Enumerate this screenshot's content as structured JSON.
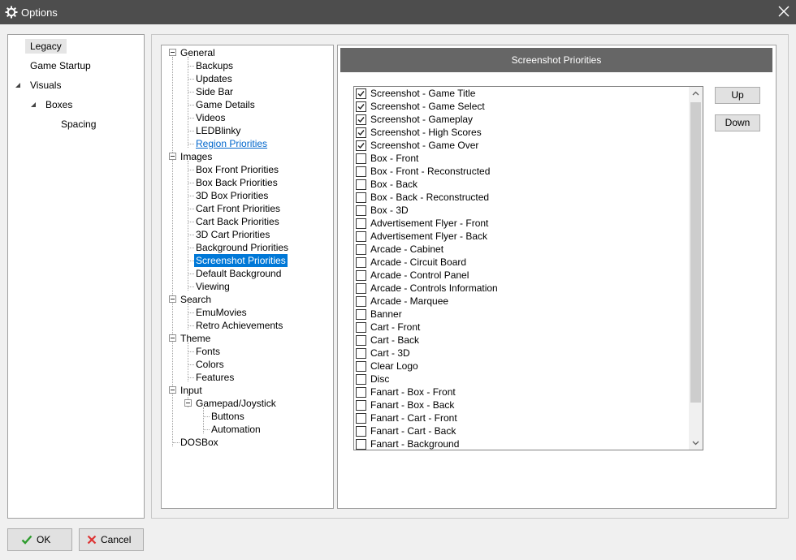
{
  "window": {
    "title": "Options",
    "icon": "gear-icon",
    "close_icon": "close-icon"
  },
  "left_tree": {
    "items": [
      {
        "label": "Legacy",
        "selected": true
      },
      {
        "label": "Game Startup"
      },
      {
        "label": "Visuals",
        "expanded": true
      },
      {
        "label": "Boxes",
        "expanded": true
      },
      {
        "label": "Spacing"
      }
    ]
  },
  "mid_tree": {
    "groups": [
      {
        "label": "General",
        "children": [
          "Backups",
          "Updates",
          "Side Bar",
          "Game Details",
          "Videos",
          "LEDBlinky",
          "Region Priorities"
        ]
      },
      {
        "label": "Images",
        "children": [
          "Box Front Priorities",
          "Box Back Priorities",
          "3D Box Priorities",
          "Cart Front Priorities",
          "Cart Back Priorities",
          "3D Cart Priorities",
          "Background Priorities",
          "Screenshot Priorities",
          "Default Background",
          "Viewing"
        ]
      },
      {
        "label": "Search",
        "children": [
          "EmuMovies",
          "Retro Achievements"
        ]
      },
      {
        "label": "Theme",
        "children": [
          "Fonts",
          "Colors",
          "Features"
        ]
      },
      {
        "label": "Input",
        "sub": {
          "label": "Gamepad/Joystick",
          "children": [
            "Buttons",
            "Automation"
          ]
        }
      },
      {
        "label": "DOSBox"
      }
    ],
    "selected": "Screenshot Priorities",
    "link": "Region Priorities"
  },
  "panel": {
    "header": "Screenshot Priorities",
    "up_label": "Up",
    "down_label": "Down",
    "items": [
      {
        "label": "Screenshot - Game Title",
        "checked": true
      },
      {
        "label": "Screenshot - Game Select",
        "checked": true
      },
      {
        "label": "Screenshot - Gameplay",
        "checked": true
      },
      {
        "label": "Screenshot - High Scores",
        "checked": true
      },
      {
        "label": "Screenshot - Game Over",
        "checked": true
      },
      {
        "label": "Box - Front",
        "checked": false
      },
      {
        "label": "Box - Front - Reconstructed",
        "checked": false
      },
      {
        "label": "Box - Back",
        "checked": false
      },
      {
        "label": "Box - Back - Reconstructed",
        "checked": false
      },
      {
        "label": "Box - 3D",
        "checked": false
      },
      {
        "label": "Advertisement Flyer - Front",
        "checked": false
      },
      {
        "label": "Advertisement Flyer - Back",
        "checked": false
      },
      {
        "label": "Arcade - Cabinet",
        "checked": false
      },
      {
        "label": "Arcade - Circuit Board",
        "checked": false
      },
      {
        "label": "Arcade - Control Panel",
        "checked": false
      },
      {
        "label": "Arcade - Controls Information",
        "checked": false
      },
      {
        "label": "Arcade - Marquee",
        "checked": false
      },
      {
        "label": "Banner",
        "checked": false
      },
      {
        "label": "Cart - Front",
        "checked": false
      },
      {
        "label": "Cart - Back",
        "checked": false
      },
      {
        "label": "Cart - 3D",
        "checked": false
      },
      {
        "label": "Clear Logo",
        "checked": false
      },
      {
        "label": "Disc",
        "checked": false
      },
      {
        "label": "Fanart - Box - Front",
        "checked": false
      },
      {
        "label": "Fanart - Box - Back",
        "checked": false
      },
      {
        "label": "Fanart - Cart - Front",
        "checked": false
      },
      {
        "label": "Fanart - Cart - Back",
        "checked": false
      },
      {
        "label": "Fanart - Background",
        "checked": false
      }
    ]
  },
  "footer": {
    "ok_label": "OK",
    "cancel_label": "Cancel",
    "ok_icon": "checkmark-icon",
    "cancel_icon": "x-icon"
  },
  "colors": {
    "titlebar": "#4d4d4d",
    "selection": "#0078d7",
    "link": "#0066cc",
    "header": "#666666"
  }
}
